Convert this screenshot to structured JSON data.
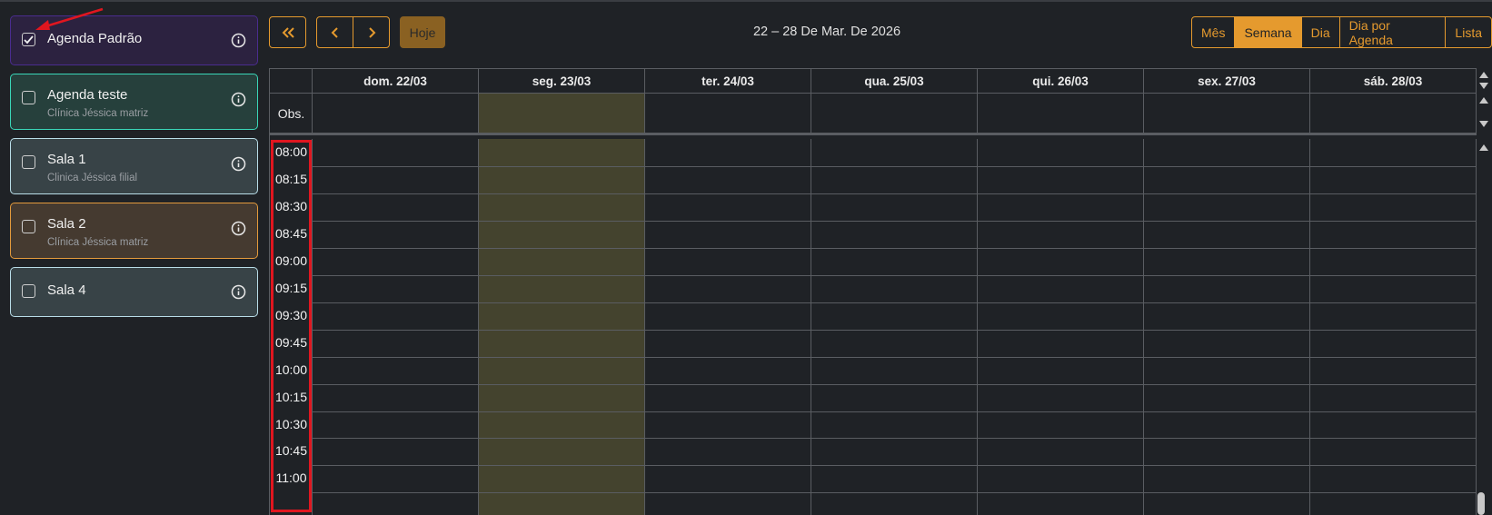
{
  "sidebar": {
    "agendas": [
      {
        "name": "Agenda Padrão",
        "subtitle": "",
        "checked": true,
        "bg": "#2c2240",
        "border": "#4a2c8f"
      },
      {
        "name": "Agenda teste",
        "subtitle": "Clínica Jéssica matriz",
        "checked": false,
        "bg": "#26403c",
        "border": "#3ad6b8"
      },
      {
        "name": "Sala 1",
        "subtitle": "Clinica Jéssica filial",
        "checked": false,
        "bg": "#384347",
        "border": "#b9dde8"
      },
      {
        "name": "Sala 2",
        "subtitle": "Clínica Jéssica matriz",
        "checked": false,
        "bg": "#453a30",
        "border": "#e39a3c"
      },
      {
        "name": "Sala 4",
        "subtitle": "",
        "checked": false,
        "bg": "#384347",
        "border": "#b9dde8"
      }
    ]
  },
  "toolbar": {
    "first_icon": "double-chevron-left-icon",
    "prev_icon": "chevron-left-icon",
    "next_icon": "chevron-right-icon",
    "today_label": "Hoje",
    "range_title": "22 – 28 De Mar. De 2026",
    "views": [
      "Mês",
      "Semana",
      "Dia",
      "Dia por Agenda",
      "Lista"
    ],
    "active_view": "Semana"
  },
  "calendar": {
    "days": [
      "dom. 22/03",
      "seg. 23/03",
      "ter. 24/03",
      "qua. 25/03",
      "qui. 26/03",
      "sex. 27/03",
      "sáb. 28/03"
    ],
    "highlight_day": "seg. 23/03",
    "obs_label": "Obs.",
    "times": [
      "08:00",
      "08:15",
      "08:30",
      "08:45",
      "09:00",
      "09:15",
      "09:30",
      "09:45",
      "10:00",
      "10:15",
      "10:30",
      "10:45",
      "11:00"
    ]
  },
  "colors": {
    "accent": "#e59a2e",
    "highlight": "#44432e",
    "annotation_red": "#e0161f"
  }
}
